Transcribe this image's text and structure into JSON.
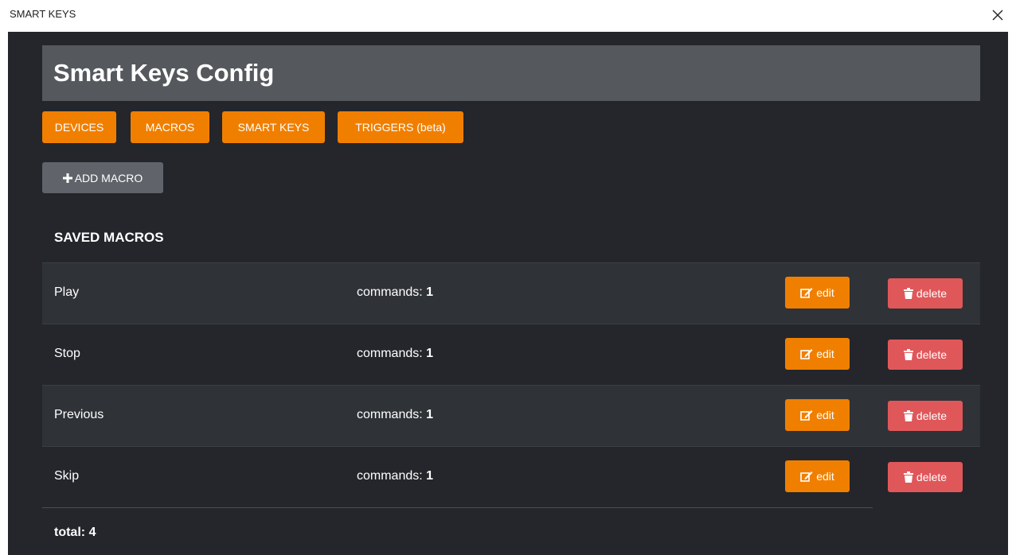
{
  "window": {
    "title": "SMART KEYS",
    "close_icon": "close-icon"
  },
  "header": {
    "title": "Smart Keys Config"
  },
  "nav": {
    "tabs": [
      {
        "label": "DEVICES"
      },
      {
        "label": "MACROS"
      },
      {
        "label": "SMART KEYS"
      },
      {
        "label": "TRIGGERS (beta)"
      }
    ]
  },
  "actions": {
    "add_label": "ADD MACRO",
    "add_icon": "plus-icon"
  },
  "macros": {
    "section_title": "SAVED MACROS",
    "commands_label": "commands:",
    "edit_label": "edit",
    "delete_label": "delete",
    "edit_icon": "edit-icon",
    "delete_icon": "trash-icon",
    "rows": [
      {
        "name": "Play",
        "commands": "1"
      },
      {
        "name": "Stop",
        "commands": "1"
      },
      {
        "name": "Previous",
        "commands": "1"
      },
      {
        "name": "Skip",
        "commands": "1"
      }
    ],
    "total_label": "total:",
    "total": "4"
  },
  "colors": {
    "background": "#24262b",
    "header": "#55585d",
    "accent": "#f07f00",
    "danger": "#e0575a",
    "secondary": "#60646a",
    "row_alt": "#2f3237"
  }
}
